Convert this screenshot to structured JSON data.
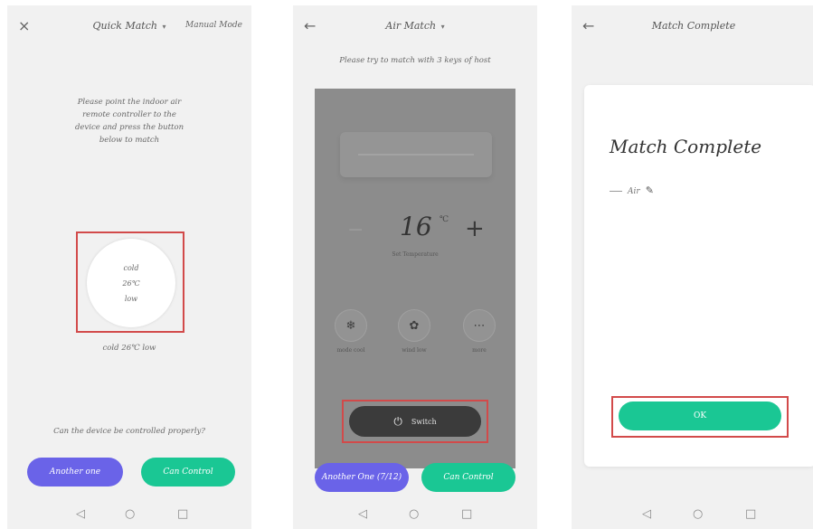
{
  "screen1": {
    "close_icon": "×",
    "title": "Quick Match",
    "title_caret": "▾",
    "right_link": "Manual Mode",
    "instruction": "Please point the indoor air remote controller to the device and press the button below to match",
    "key_lines": [
      "cold",
      "26℃",
      "low"
    ],
    "key_caption": "cold 26℃ low",
    "question": "Can the device be controlled properly?",
    "btn_another": "Another one",
    "btn_can": "Can Control"
  },
  "screen2": {
    "back_icon": "←",
    "title": "Air Match",
    "title_caret": "▾",
    "hint": "Please try to match with 3 keys of host",
    "minus": "−",
    "plus": "+",
    "temp_value": "16",
    "temp_unit": "℃",
    "temp_label": "Set Temperature",
    "modes": [
      {
        "icon": "❄",
        "label": "mode cool"
      },
      {
        "icon": "✿",
        "label": "wind low"
      },
      {
        "icon": "⋯",
        "label": "more"
      }
    ],
    "switch_icon": "⏻",
    "switch_label": "Switch",
    "btn_another": "Another One (7/12)",
    "btn_can": "Can Control"
  },
  "screen3": {
    "back_icon": "←",
    "title": "Match Complete",
    "card_title": "Match Complete",
    "device_name": "Air",
    "edit_icon": "✎",
    "ok_label": "OK"
  },
  "sysnav": {
    "back": "◁",
    "home": "○",
    "recent": "□"
  },
  "colors": {
    "accent_purple": "#6a63e8",
    "accent_green": "#1ac794",
    "highlight_red": "#d24a4a"
  }
}
